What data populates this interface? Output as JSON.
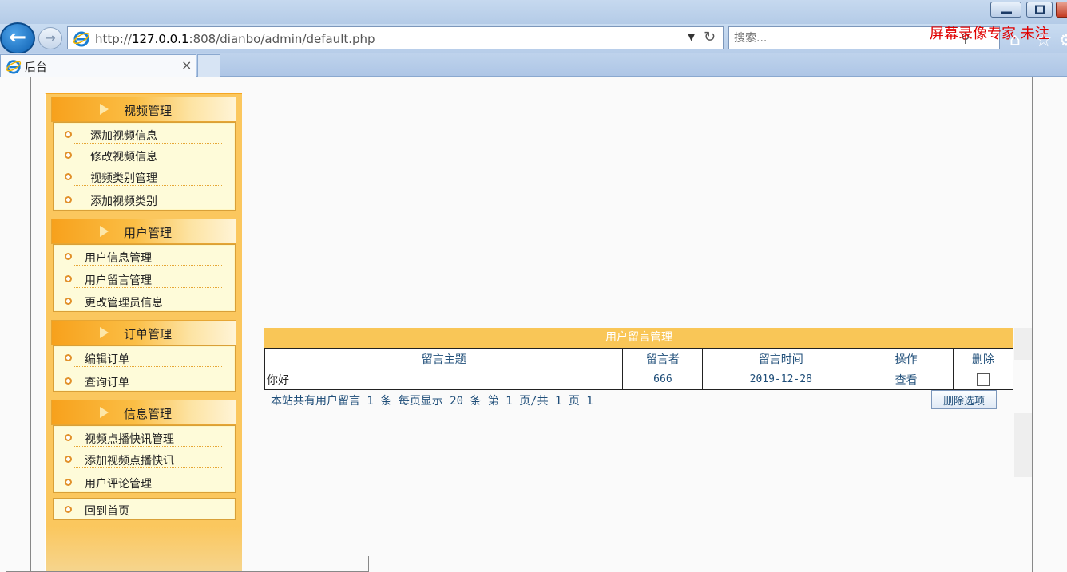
{
  "browser": {
    "url_prefix": "http://",
    "url_host": "127.0.0.1",
    "url_rest": ":808/dianbo/admin/default.php",
    "search_placeholder": "搜索...",
    "tab_title": "后台",
    "watermark": "屏幕录像专家  未注"
  },
  "sidebar": {
    "sections": [
      {
        "title": "视频管理",
        "items": [
          "添加视频信息",
          "修改视频信息",
          "视频类别管理",
          "添加视频类别"
        ]
      },
      {
        "title": "用户管理",
        "items": [
          "用户信息管理",
          "用户留言管理",
          "更改管理员信息"
        ]
      },
      {
        "title": "订单管理",
        "items": [
          "编辑订单",
          "查询订单"
        ]
      },
      {
        "title": "信息管理",
        "items": [
          "视频点播快讯管理",
          "添加视频点播快讯",
          "用户评论管理"
        ]
      }
    ],
    "home_link": "回到首页"
  },
  "messages": {
    "title": "用户留言管理",
    "columns": [
      "留言主题",
      "留言者",
      "留言时间",
      "操作",
      "删除"
    ],
    "rows": [
      {
        "subject": "你好",
        "author": "666",
        "time": "2019-12-28",
        "action": "查看",
        "selected": false
      }
    ],
    "pager": "本站共有用户留言 1 条 每页显示 20 条 第 1 页/共 1 页 1",
    "delete_button": "删除选项"
  },
  "colors": {
    "sidebar_bg": "#fbc75e",
    "panel_header": "#f9c657",
    "link_text": "#1f4e79",
    "watermark": "#e00000"
  }
}
